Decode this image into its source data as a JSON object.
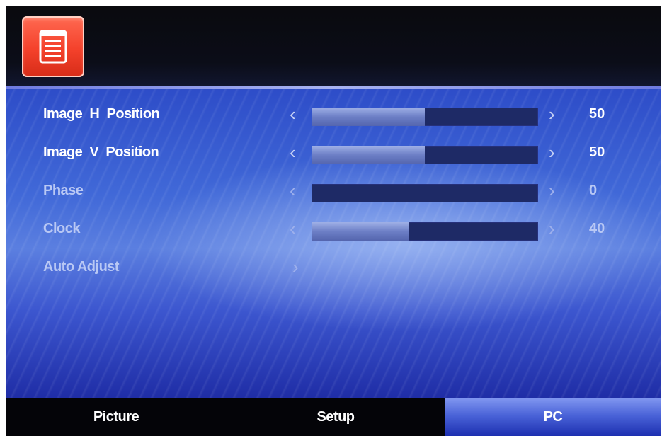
{
  "header": {
    "menu_icon": "menu-list-icon"
  },
  "settings": [
    {
      "label": "Image  H  Position",
      "value": "50",
      "level": 0.5,
      "enabled": true
    },
    {
      "label": "Image  V  Position",
      "value": "50",
      "level": 0.5,
      "enabled": true
    },
    {
      "label": "Phase",
      "value": "0",
      "level": 0.0,
      "enabled": false
    },
    {
      "label": "Clock",
      "value": "40",
      "level": 0.43,
      "enabled": false
    },
    {
      "label": "Auto Adjust",
      "enabled": false
    }
  ],
  "tabs": [
    {
      "label": "Picture",
      "active": false
    },
    {
      "label": "Setup",
      "active": false
    },
    {
      "label": "PC",
      "active": true
    }
  ],
  "colors": {
    "accent": "#f4412b",
    "active_tab": "#4a63d8",
    "panel_blue": "#4169d8"
  }
}
